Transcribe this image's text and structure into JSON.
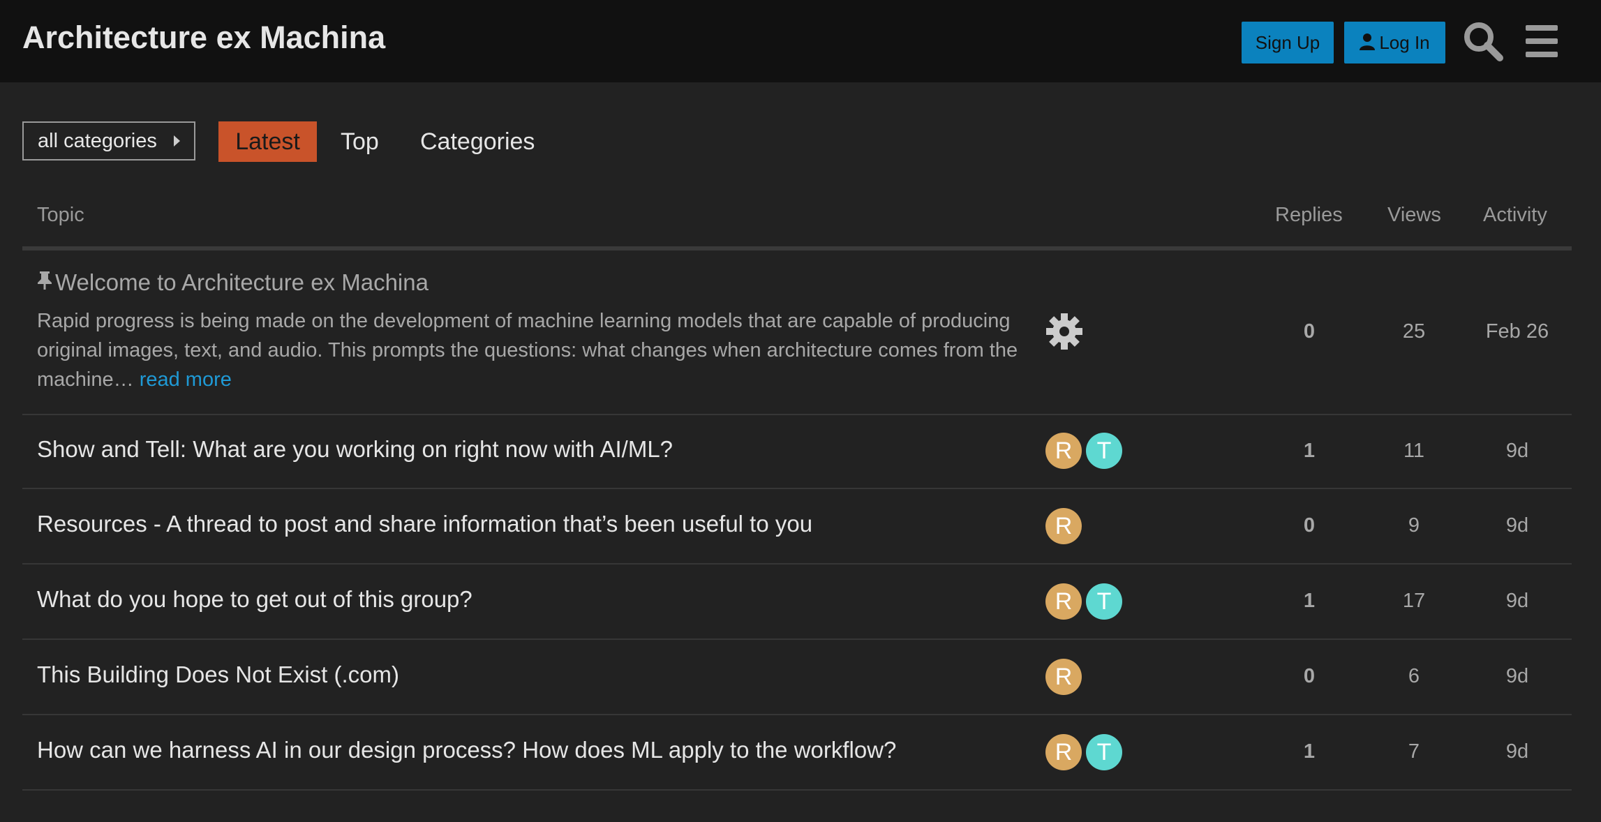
{
  "header": {
    "site_title": "Architecture ex Machina",
    "signup_label": "Sign Up",
    "login_label": "Log In"
  },
  "nav": {
    "category_dropdown": "all categories",
    "tabs": [
      {
        "label": "Latest",
        "active": true
      },
      {
        "label": "Top",
        "active": false
      },
      {
        "label": "Categories",
        "active": false
      }
    ]
  },
  "table": {
    "columns": {
      "topic": "Topic",
      "replies": "Replies",
      "views": "Views",
      "activity": "Activity"
    },
    "pinned": {
      "title": "Welcome to Architecture ex Machina",
      "excerpt": "Rapid progress is being made on the development of machine learning models that are capable of producing original images, text, and audio. This prompts the questions: what changes when architecture comes from the machine…",
      "read_more": "read more",
      "replies": "0",
      "views": "25",
      "activity": "Feb 26"
    },
    "topics": [
      {
        "title": "Show and Tell: What are you working on right now with AI/ML?",
        "posters": [
          "R",
          "T"
        ],
        "replies": "1",
        "views": "11",
        "activity": "9d"
      },
      {
        "title": "Resources - A thread to post and share information that’s been useful to you",
        "posters": [
          "R"
        ],
        "replies": "0",
        "views": "9",
        "activity": "9d"
      },
      {
        "title": "What do you hope to get out of this group?",
        "posters": [
          "R",
          "T"
        ],
        "replies": "1",
        "views": "17",
        "activity": "9d"
      },
      {
        "title": "This Building Does Not Exist (.com)",
        "posters": [
          "R"
        ],
        "replies": "0",
        "views": "6",
        "activity": "9d"
      },
      {
        "title": "How can we harness AI in our design process? How does ML apply to the workflow?",
        "posters": [
          "R",
          "T"
        ],
        "replies": "1",
        "views": "7",
        "activity": "9d"
      }
    ]
  },
  "colors": {
    "accent_latest": "#c9532a",
    "button_blue": "#0b82be",
    "link_blue": "#1f9ad6",
    "avatar_r": "#d9a861",
    "avatar_t": "#5ed8d1"
  },
  "icons": [
    "user-icon",
    "search-icon",
    "menu-icon",
    "pin-icon",
    "gear-icon"
  ]
}
